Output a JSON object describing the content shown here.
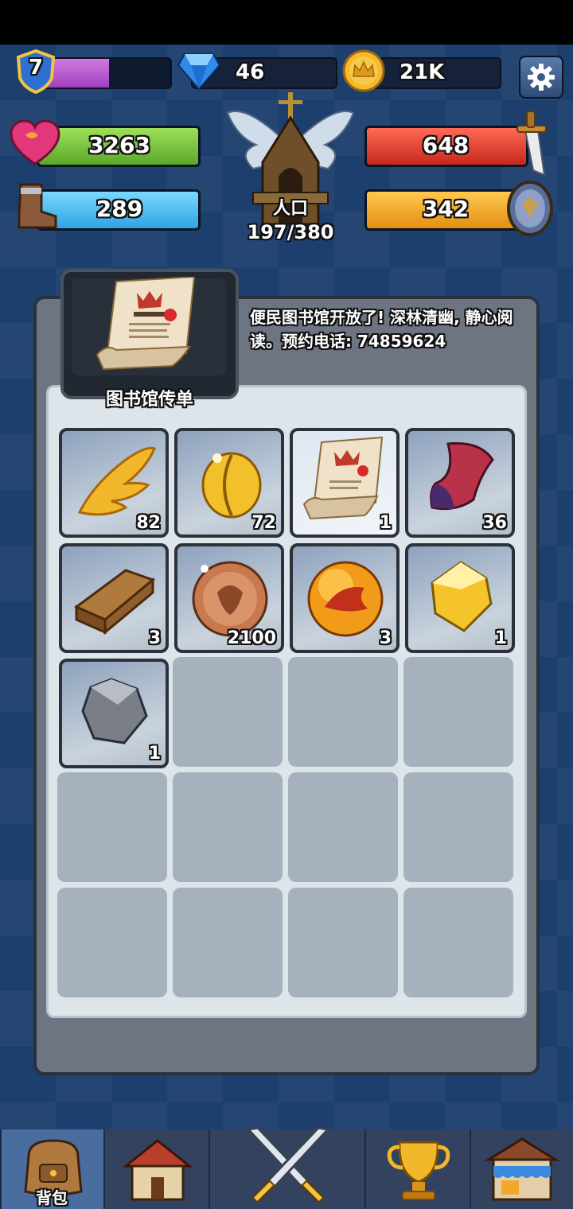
{
  "top_bar": {
    "level": "7",
    "xp_progress": 0.52,
    "gems": "46",
    "gold": "21K",
    "settings_icon": "gear-icon"
  },
  "stats": {
    "health": "3263",
    "attack": "648",
    "speed": "289",
    "defense": "342",
    "population_label": "人口",
    "population": "197/380"
  },
  "selected_item": {
    "name": "图书馆传单",
    "description": "便民图书馆开放了! 深林清幽, 静心阅读。预约电话: 74859624"
  },
  "inventory": [
    {
      "icon": "golden-wing-icon",
      "qty": "82"
    },
    {
      "icon": "golden-seed-icon",
      "qty": "72"
    },
    {
      "icon": "library-flyer-icon",
      "qty": "1"
    },
    {
      "icon": "cloth-scrap-icon",
      "qty": "36"
    },
    {
      "icon": "wood-plank-icon",
      "qty": "3"
    },
    {
      "icon": "copper-coin-icon",
      "qty": "2100"
    },
    {
      "icon": "dragon-orb-icon",
      "qty": "3"
    },
    {
      "icon": "gold-crystal-icon",
      "qty": "1"
    },
    {
      "icon": "stone-icon",
      "qty": "1"
    }
  ],
  "nav": {
    "backpack_label": "背包",
    "items": [
      "backpack-icon",
      "house-icon",
      "crossed-swords-icon",
      "trophy-icon",
      "shop-icon"
    ]
  },
  "colors": {
    "health": "#7ec83a",
    "attack": "#e0402f",
    "speed": "#3cb8ee",
    "defense": "#f2a82a",
    "xp": "#b54fd0"
  }
}
